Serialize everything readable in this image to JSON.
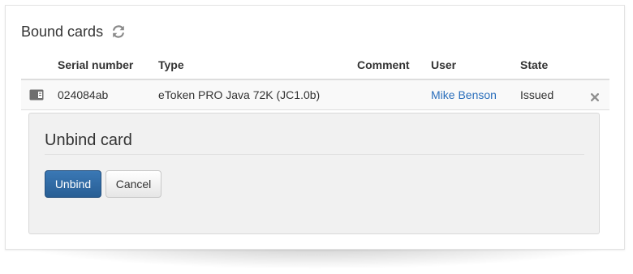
{
  "panel": {
    "title": "Bound cards",
    "refresh_icon": "refresh-icon"
  },
  "table": {
    "headers": [
      "",
      "Serial number",
      "Type",
      "Comment",
      "User",
      "State",
      ""
    ],
    "rows": [
      {
        "icon": "card-reader-icon",
        "serial": "024084ab",
        "type": "eToken PRO Java 72K (JC1.0b)",
        "comment": "",
        "user": "Mike Benson",
        "state": "Issued",
        "action_icon": "remove-icon"
      }
    ]
  },
  "unbind": {
    "title": "Unbind card",
    "unbind_label": "Unbind",
    "cancel_label": "Cancel"
  },
  "colors": {
    "link": "#2a6ebb",
    "primary_button": "#2f6aa6"
  }
}
